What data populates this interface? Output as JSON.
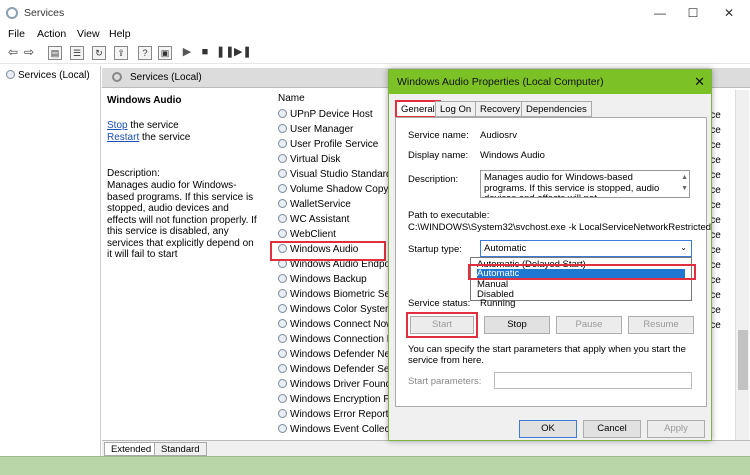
{
  "window": {
    "title": "Services",
    "minimize": "—",
    "maximize": "☐",
    "close": "✕"
  },
  "menu": [
    "File",
    "Action",
    "View",
    "Help"
  ],
  "left_pane": {
    "item": "Services (Local)"
  },
  "main_header": {
    "title": "Services (Local)"
  },
  "desc": {
    "service_name": "Windows Audio",
    "stop_link": "Stop",
    "stop_rest": " the service",
    "restart_link": "Restart",
    "restart_rest": " the service",
    "description_label": "Description:",
    "description_text": "Manages audio for Windows-based programs. If this service is stopped, audio devices and effects will not function properly. If this service is disabled, any services that explicitly depend on it will fail to start"
  },
  "list": {
    "column_name": "Name",
    "rows": [
      "UPnP Device Host",
      "User Manager",
      "User Profile Service",
      "Virtual Disk",
      "Visual Studio Standard C",
      "Volume Shadow Copy",
      "WalletService",
      "WC Assistant",
      "WebClient",
      "Windows Audio",
      "Windows Audio Endpoi",
      "Windows Backup",
      "Windows Biometric Ser",
      "Windows Color System",
      "Windows Connect Now",
      "Windows Connection M",
      "Windows Defender Net",
      "Windows Defender Ser",
      "Windows Driver Found",
      "Windows Encryption Pr",
      "Windows Error Reportin",
      "Windows Event Collect"
    ],
    "right_col": [
      "ice",
      "ice",
      "ice",
      "ice",
      "ice",
      "ice",
      "ice",
      "ice",
      "ice",
      "ice",
      "ice",
      "ice",
      "ice",
      "ice",
      "ice"
    ]
  },
  "bottom_tabs": [
    "Extended",
    "Standard"
  ],
  "dialog": {
    "title": "Windows Audio Properties (Local Computer)",
    "close": "✕",
    "tabs": [
      "General",
      "Log On",
      "Recovery",
      "Dependencies"
    ],
    "service_name_label": "Service name:",
    "service_name_value": "Audiosrv",
    "display_name_label": "Display name:",
    "display_name_value": "Windows Audio",
    "description_label": "Description:",
    "description_value": "Manages audio for Windows-based programs. If this service is stopped, audio devices and effects will not",
    "path_label": "Path to executable:",
    "path_value": "C:\\WINDOWS\\System32\\svchost.exe -k LocalServiceNetworkRestricted",
    "startup_type_label": "Startup type:",
    "startup_type_value": "Automatic",
    "startup_options": [
      "Automatic (Delayed Start)",
      "Automatic",
      "Manual",
      "Disabled"
    ],
    "service_status_label": "Service status:",
    "service_status_value": "Running",
    "buttons": {
      "start": "Start",
      "stop": "Stop",
      "pause": "Pause",
      "resume": "Resume"
    },
    "hint": "You can specify the start parameters that apply when you start the service from here.",
    "start_params_label": "Start parameters:",
    "ok": "OK",
    "cancel": "Cancel",
    "apply": "Apply"
  }
}
